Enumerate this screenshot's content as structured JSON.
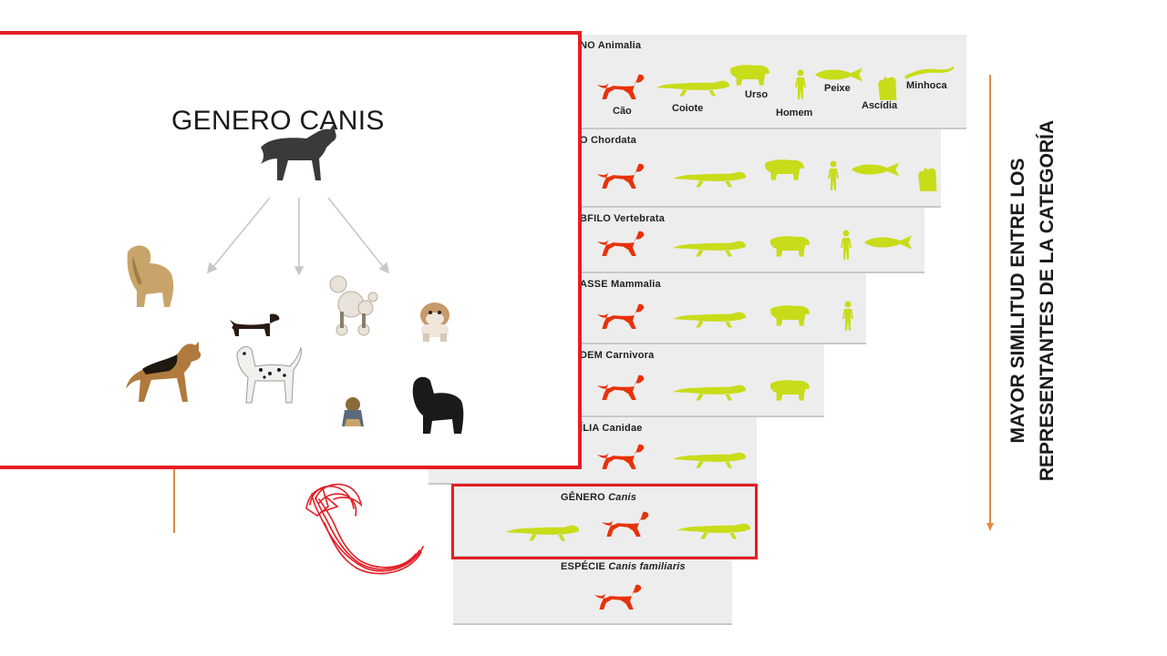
{
  "box": {
    "title": "GENERO CANIS"
  },
  "levels": [
    {
      "title": "NO Animalia",
      "labels": [
        "Cão",
        "Coiote",
        "Urso",
        "Homem",
        "Peixe",
        "Ascídia",
        "Minhoca"
      ]
    },
    {
      "title": "O Chordata"
    },
    {
      "title": "BFILO Vertebrata"
    },
    {
      "title": "ASSE Mammalia"
    },
    {
      "title": "DEM Carnivora"
    },
    {
      "title": "ÍLIA Canidae"
    },
    {
      "title_prefix": "GÊNERO",
      "title_italic": "Canis"
    },
    {
      "title_prefix": "ESPÉCIE",
      "title_italic": "Canis familiaris"
    }
  ],
  "side_text": {
    "line1": "MAYOR SIMILITUD ENTRE LOS",
    "line2": "REPRESENTANTES DE LA CATEGORÍA"
  },
  "colors": {
    "frame": "#e41e24",
    "dog_silhouette": "#e8320a",
    "other_animals": "#c8dc1a",
    "arrow": "#e08a45"
  }
}
